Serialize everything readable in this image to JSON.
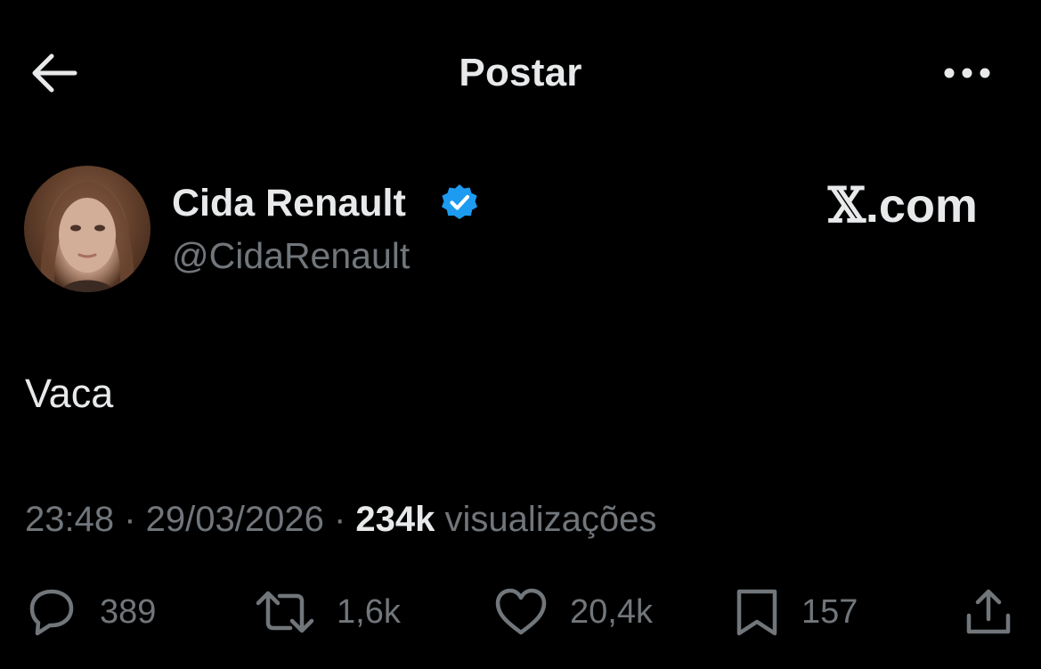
{
  "header": {
    "title": "Postar",
    "back_icon": "arrow-left-icon",
    "more_icon": "more-horizontal-icon"
  },
  "author": {
    "display_name": "Cida Renault",
    "handle": "@CidaRenault",
    "verified": true,
    "verified_color": "#1d9bf0"
  },
  "watermark": {
    "x_glyph": "𝕏",
    "suffix": ".com"
  },
  "post": {
    "text": "Vaca"
  },
  "meta": {
    "time": "23:48",
    "separator": " · ",
    "date": "29/03/2026",
    "views_count": "234k",
    "views_label": "visualizações"
  },
  "actions": {
    "replies": "389",
    "reposts": "1,6k",
    "likes": "20,4k",
    "bookmarks": "157"
  },
  "colors": {
    "background": "#000000",
    "primary_text": "#e7e9ea",
    "secondary_text": "#71767b",
    "accent": "#1d9bf0"
  }
}
